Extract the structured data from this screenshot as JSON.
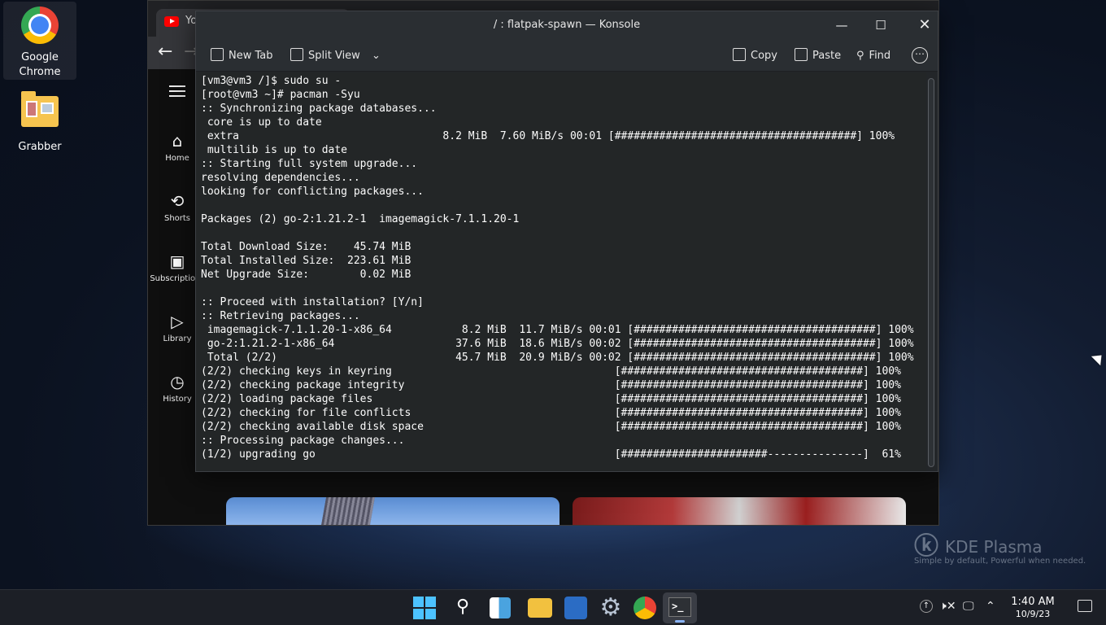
{
  "desktop": {
    "icons": [
      {
        "label": "Google\nChrome",
        "icon": "chrome-icon"
      },
      {
        "label": "Grabber",
        "icon": "folder-icon"
      }
    ],
    "branding": {
      "name": "KDE Plasma",
      "tagline": "Simple by default, Powerful when  needed."
    }
  },
  "browser": {
    "tab_title": "Yo",
    "sidebar": [
      {
        "label": "Home",
        "icon": "home-icon"
      },
      {
        "label": "Shorts",
        "icon": "shorts-icon"
      },
      {
        "label": "Subscriptions",
        "icon": "subscriptions-icon"
      },
      {
        "label": "Library",
        "icon": "library-icon"
      },
      {
        "label": "History",
        "icon": "history-icon"
      }
    ]
  },
  "konsole": {
    "title": "/ : flatpak-spawn — Konsole",
    "toolbar": {
      "new_tab": "New Tab",
      "split_view": "Split View",
      "copy": "Copy",
      "paste": "Paste",
      "find": "Find"
    },
    "lines": [
      "[vm3@vm3 /]$ sudo su -",
      "[root@vm3 ~]# pacman -Syu",
      ":: Synchronizing package databases...",
      " core is up to date",
      " extra                                8.2 MiB  7.60 MiB/s 00:01 [######################################] 100%",
      " multilib is up to date",
      ":: Starting full system upgrade...",
      "resolving dependencies...",
      "looking for conflicting packages...",
      "",
      "Packages (2) go-2:1.21.2-1  imagemagick-7.1.1.20-1",
      "",
      "Total Download Size:    45.74 MiB",
      "Total Installed Size:  223.61 MiB",
      "Net Upgrade Size:        0.02 MiB",
      "",
      ":: Proceed with installation? [Y/n]",
      ":: Retrieving packages...",
      " imagemagick-7.1.1.20-1-x86_64           8.2 MiB  11.7 MiB/s 00:01 [######################################] 100%",
      " go-2:1.21.2-1-x86_64                   37.6 MiB  18.6 MiB/s 00:02 [######################################] 100%",
      " Total (2/2)                            45.7 MiB  20.9 MiB/s 00:02 [######################################] 100%",
      "(2/2) checking keys in keyring                                   [######################################] 100%",
      "(2/2) checking package integrity                                 [######################################] 100%",
      "(2/2) loading package files                                      [######################################] 100%",
      "(2/2) checking for file conflicts                                [######################################] 100%",
      "(2/2) checking available disk space                              [######################################] 100%",
      ":: Processing package changes...",
      "(1/2) upgrading go                                               [#######################---------------]  61%"
    ]
  },
  "taskbar": {
    "apps": [
      "start-icon",
      "search-icon",
      "widgets-icon",
      "file-explorer-icon",
      "store-icon",
      "settings-icon",
      "chrome-icon",
      "terminal-icon"
    ],
    "clock": {
      "time": "1:40 AM",
      "date": "10/9/23"
    }
  }
}
